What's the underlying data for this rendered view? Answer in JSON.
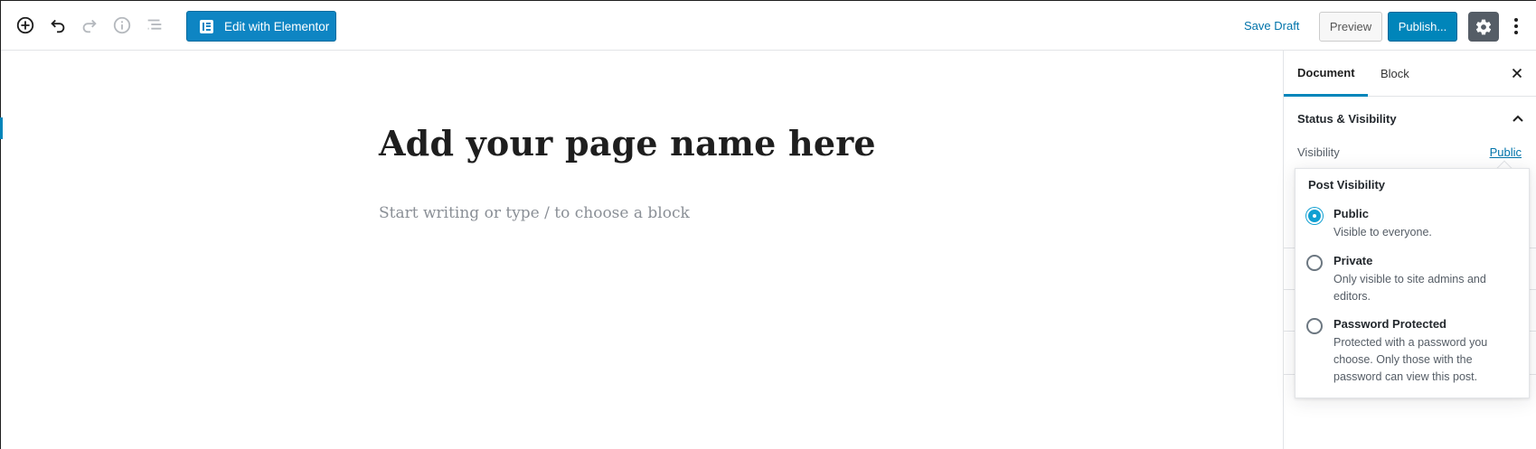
{
  "toolbar": {
    "edit_with_elementor_label": "Edit with Elementor",
    "save_draft_label": "Save Draft",
    "preview_label": "Preview",
    "publish_label": "Publish..."
  },
  "editor": {
    "title_placeholder": "Add your page name here",
    "block_placeholder": "Start writing or type / to choose a block"
  },
  "sidebar": {
    "tabs": [
      {
        "label": "Document",
        "active": true
      },
      {
        "label": "Block",
        "active": false
      }
    ],
    "panel_title": "Status & Visibility",
    "visibility_label": "Visibility",
    "visibility_value": "Public"
  },
  "popover": {
    "title": "Post Visibility",
    "options": [
      {
        "label": "Public",
        "description": "Visible to everyone.",
        "selected": true
      },
      {
        "label": "Private",
        "description": "Only visible to site admins and editors.",
        "selected": false
      },
      {
        "label": "Password Protected",
        "description": "Protected with a password you choose. Only those with the password can view this post.",
        "selected": false
      }
    ]
  },
  "colors": {
    "primary": "#0085ba",
    "elementor": "#0e85c3",
    "link": "#0073aa",
    "settings_bg": "#555d66"
  }
}
